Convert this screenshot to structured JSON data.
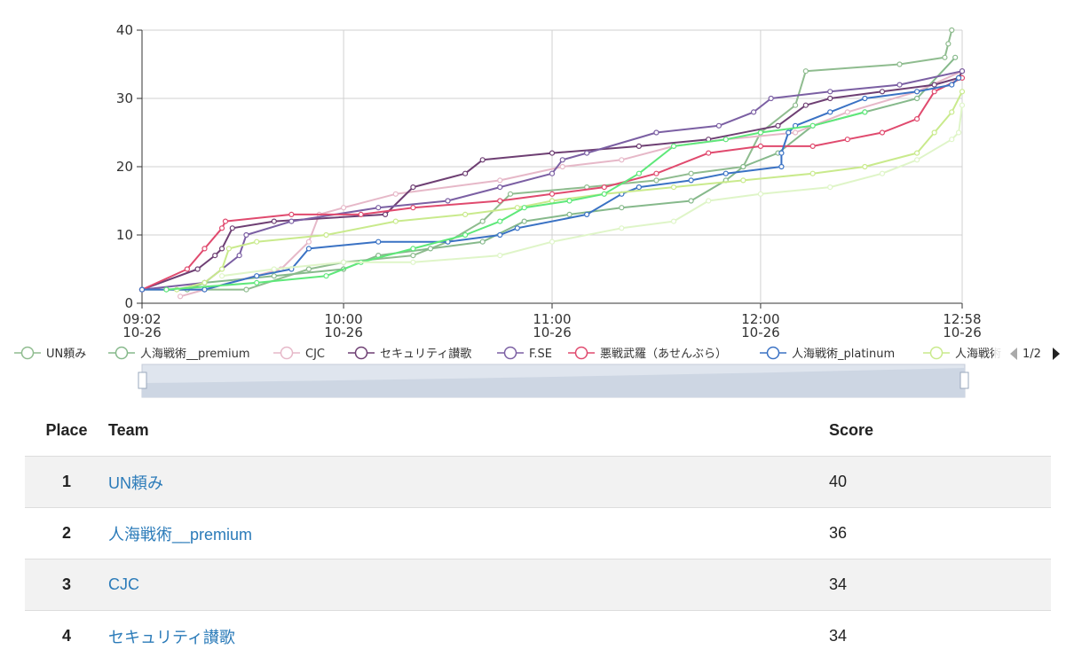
{
  "chart_data": {
    "type": "line",
    "x_unit": "time",
    "x_start": "09:02",
    "x_end": "12:58",
    "x_ticks": [
      {
        "time": "09:02",
        "label": "09:02",
        "date": "10-26"
      },
      {
        "time": "10:00",
        "label": "10:00",
        "date": "10-26"
      },
      {
        "time": "11:00",
        "label": "11:00",
        "date": "10-26"
      },
      {
        "time": "12:00",
        "label": "12:00",
        "date": "10-26"
      },
      {
        "time": "12:58",
        "label": "12:58",
        "date": "10-26"
      }
    ],
    "ylim": [
      0,
      40
    ],
    "y_ticks": [
      0,
      10,
      20,
      30,
      40
    ],
    "grid": true,
    "legend_position": "bottom",
    "legend_page": "1/2",
    "series": [
      {
        "name": "UN頼み",
        "color": "#8fbc8f",
        "points": [
          [
            "09:09",
            2
          ],
          [
            "09:32",
            2
          ],
          [
            "09:50",
            5
          ],
          [
            "10:00",
            6
          ],
          [
            "10:20",
            7
          ],
          [
            "10:30",
            9
          ],
          [
            "10:40",
            12
          ],
          [
            "10:48",
            16
          ],
          [
            "11:10",
            17
          ],
          [
            "11:30",
            18
          ],
          [
            "11:40",
            19
          ],
          [
            "11:55",
            20
          ],
          [
            "12:00",
            25
          ],
          [
            "12:10",
            29
          ],
          [
            "12:13",
            34
          ],
          [
            "12:40",
            35
          ],
          [
            "12:53",
            36
          ],
          [
            "12:54",
            38
          ],
          [
            "12:55",
            40
          ]
        ]
      },
      {
        "name": "人海戦術__premium",
        "color": "#86b98b",
        "points": [
          [
            "09:02",
            2
          ],
          [
            "09:15",
            2
          ],
          [
            "09:20",
            3
          ],
          [
            "09:40",
            4
          ],
          [
            "10:00",
            5
          ],
          [
            "10:10",
            7
          ],
          [
            "10:25",
            8
          ],
          [
            "10:40",
            9
          ],
          [
            "10:52",
            12
          ],
          [
            "11:05",
            13
          ],
          [
            "11:20",
            14
          ],
          [
            "11:40",
            15
          ],
          [
            "11:50",
            18
          ],
          [
            "11:55",
            20
          ],
          [
            "12:05",
            22
          ],
          [
            "12:15",
            26
          ],
          [
            "12:30",
            28
          ],
          [
            "12:45",
            30
          ],
          [
            "12:56",
            36
          ]
        ]
      },
      {
        "name": "CJC",
        "color": "#e6b8c8",
        "points": [
          [
            "09:13",
            1
          ],
          [
            "09:20",
            2
          ],
          [
            "09:42",
            5
          ],
          [
            "09:50",
            9
          ],
          [
            "09:53",
            13
          ],
          [
            "10:00",
            14
          ],
          [
            "10:15",
            16
          ],
          [
            "10:45",
            18
          ],
          [
            "11:03",
            20
          ],
          [
            "11:20",
            21
          ],
          [
            "11:35",
            23
          ],
          [
            "11:50",
            24
          ],
          [
            "12:10",
            25
          ],
          [
            "12:25",
            28
          ],
          [
            "12:45",
            31
          ],
          [
            "12:58",
            34
          ]
        ]
      },
      {
        "name": "セキュリティ讃歌",
        "color": "#6e3f73",
        "points": [
          [
            "09:02",
            2
          ],
          [
            "09:18",
            5
          ],
          [
            "09:23",
            7
          ],
          [
            "09:25",
            8
          ],
          [
            "09:28",
            11
          ],
          [
            "09:40",
            12
          ],
          [
            "10:12",
            13
          ],
          [
            "10:20",
            17
          ],
          [
            "10:35",
            19
          ],
          [
            "10:40",
            21
          ],
          [
            "11:00",
            22
          ],
          [
            "11:25",
            23
          ],
          [
            "11:45",
            24
          ],
          [
            "12:05",
            26
          ],
          [
            "12:13",
            29
          ],
          [
            "12:20",
            30
          ],
          [
            "12:35",
            31
          ],
          [
            "12:50",
            32
          ],
          [
            "12:57",
            33
          ],
          [
            "12:58",
            34
          ]
        ]
      },
      {
        "name": "F.SE",
        "color": "#7b5fa3",
        "points": [
          [
            "09:02",
            2
          ],
          [
            "09:20",
            3
          ],
          [
            "09:30",
            7
          ],
          [
            "09:32",
            10
          ],
          [
            "09:45",
            12
          ],
          [
            "10:10",
            14
          ],
          [
            "10:30",
            15
          ],
          [
            "10:45",
            17
          ],
          [
            "11:00",
            19
          ],
          [
            "11:03",
            21
          ],
          [
            "11:10",
            22
          ],
          [
            "11:30",
            25
          ],
          [
            "11:48",
            26
          ],
          [
            "11:58",
            28
          ],
          [
            "12:03",
            30
          ],
          [
            "12:20",
            31
          ],
          [
            "12:40",
            32
          ],
          [
            "12:58",
            34
          ]
        ]
      },
      {
        "name": "悪戦武羅（あせんぶら）",
        "color": "#e04a6e",
        "points": [
          [
            "09:02",
            2
          ],
          [
            "09:15",
            5
          ],
          [
            "09:20",
            8
          ],
          [
            "09:25",
            11
          ],
          [
            "09:26",
            12
          ],
          [
            "09:45",
            13
          ],
          [
            "10:05",
            13
          ],
          [
            "10:20",
            14
          ],
          [
            "10:45",
            15
          ],
          [
            "11:00",
            16
          ],
          [
            "11:15",
            17
          ],
          [
            "11:30",
            19
          ],
          [
            "11:45",
            22
          ],
          [
            "12:00",
            23
          ],
          [
            "12:15",
            23
          ],
          [
            "12:25",
            24
          ],
          [
            "12:35",
            25
          ],
          [
            "12:45",
            27
          ],
          [
            "12:50",
            31
          ],
          [
            "12:58",
            33
          ]
        ]
      },
      {
        "name": "人海戦術_platinum",
        "color": "#3a72c4",
        "points": [
          [
            "09:02",
            2
          ],
          [
            "09:20",
            2
          ],
          [
            "09:35",
            4
          ],
          [
            "09:45",
            5
          ],
          [
            "09:50",
            8
          ],
          [
            "10:10",
            9
          ],
          [
            "10:30",
            9
          ],
          [
            "10:45",
            10
          ],
          [
            "10:50",
            11
          ],
          [
            "11:10",
            13
          ],
          [
            "11:20",
            16
          ],
          [
            "11:25",
            17
          ],
          [
            "11:40",
            18
          ],
          [
            "11:50",
            19
          ],
          [
            "12:06",
            20
          ],
          [
            "12:06",
            22
          ],
          [
            "12:08",
            25
          ],
          [
            "12:10",
            26
          ],
          [
            "12:20",
            28
          ],
          [
            "12:30",
            30
          ],
          [
            "12:45",
            31
          ],
          [
            "12:55",
            32
          ],
          [
            "12:57",
            33
          ]
        ]
      },
      {
        "name": "人海戦術",
        "color": "#c9ea8c",
        "points": [
          [
            "09:12",
            2
          ],
          [
            "09:20",
            3
          ],
          [
            "09:25",
            5
          ],
          [
            "09:27",
            8
          ],
          [
            "09:35",
            9
          ],
          [
            "09:55",
            10
          ],
          [
            "10:15",
            12
          ],
          [
            "10:35",
            13
          ],
          [
            "10:50",
            14
          ],
          [
            "11:00",
            15
          ],
          [
            "11:15",
            16
          ],
          [
            "11:35",
            17
          ],
          [
            "11:55",
            18
          ],
          [
            "12:15",
            19
          ],
          [
            "12:30",
            20
          ],
          [
            "12:45",
            22
          ],
          [
            "12:50",
            25
          ],
          [
            "12:55",
            28
          ],
          [
            "12:58",
            31
          ]
        ]
      },
      {
        "name": "",
        "color": "#5ee87a",
        "points": [
          [
            "09:09",
            2
          ],
          [
            "09:35",
            3
          ],
          [
            "09:55",
            4
          ],
          [
            "10:05",
            6
          ],
          [
            "10:20",
            8
          ],
          [
            "10:35",
            10
          ],
          [
            "10:45",
            12
          ],
          [
            "10:52",
            14
          ],
          [
            "11:05",
            15
          ],
          [
            "11:15",
            16
          ],
          [
            "11:25",
            19
          ],
          [
            "11:35",
            23
          ],
          [
            "11:50",
            24
          ],
          [
            "12:00",
            25
          ],
          [
            "12:15",
            26
          ],
          [
            "12:30",
            28
          ]
        ]
      },
      {
        "name": "",
        "color": "#dff5c8",
        "points": [
          [
            "09:25",
            4
          ],
          [
            "09:40",
            5
          ],
          [
            "10:00",
            6
          ],
          [
            "10:20",
            6
          ],
          [
            "10:45",
            7
          ],
          [
            "11:00",
            9
          ],
          [
            "11:20",
            11
          ],
          [
            "11:35",
            12
          ],
          [
            "11:45",
            15
          ],
          [
            "12:00",
            16
          ],
          [
            "12:20",
            17
          ],
          [
            "12:35",
            19
          ],
          [
            "12:45",
            21
          ],
          [
            "12:55",
            24
          ],
          [
            "12:57",
            25
          ],
          [
            "12:58",
            29
          ]
        ]
      }
    ]
  },
  "slider": {
    "page_label": "1/2"
  },
  "table": {
    "headers": {
      "place": "Place",
      "team": "Team",
      "score": "Score"
    },
    "rows": [
      {
        "place": "1",
        "team": "UN頼み",
        "score": "40"
      },
      {
        "place": "2",
        "team": "人海戦術__premium",
        "score": "36"
      },
      {
        "place": "3",
        "team": "CJC",
        "score": "34"
      },
      {
        "place": "4",
        "team": "セキュリティ讃歌",
        "score": "34"
      }
    ]
  }
}
